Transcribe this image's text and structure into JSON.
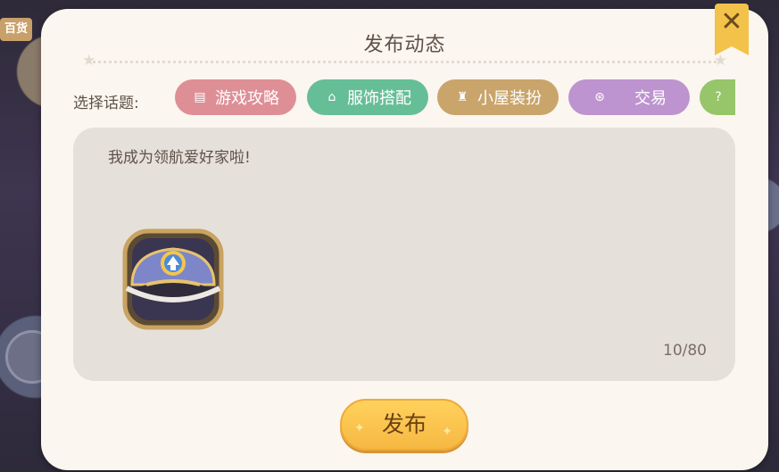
{
  "background": {
    "badge": "百货"
  },
  "dialog": {
    "title": "发布动态",
    "close_icon": "close-icon"
  },
  "topics": {
    "label": "选择话题:",
    "items": [
      {
        "label": "游戏攻略",
        "icon": "guide-icon",
        "color": "#de8f96"
      },
      {
        "label": "服饰搭配",
        "icon": "clothing-icon",
        "color": "#66be97"
      },
      {
        "label": "小屋装扮",
        "icon": "house-decor-icon",
        "color": "#c9a56c"
      },
      {
        "label": "交易",
        "icon": "trade-icon",
        "color": "#bd94cf"
      },
      {
        "label": "",
        "icon": "question-icon",
        "color": "#97c56a"
      }
    ]
  },
  "editor": {
    "text": "我成为领航爱好家啦!",
    "attachment_icon": "captain-hat-icon",
    "counter": "10/80"
  },
  "publish": {
    "label": "发布",
    "color": "#f6b843"
  }
}
